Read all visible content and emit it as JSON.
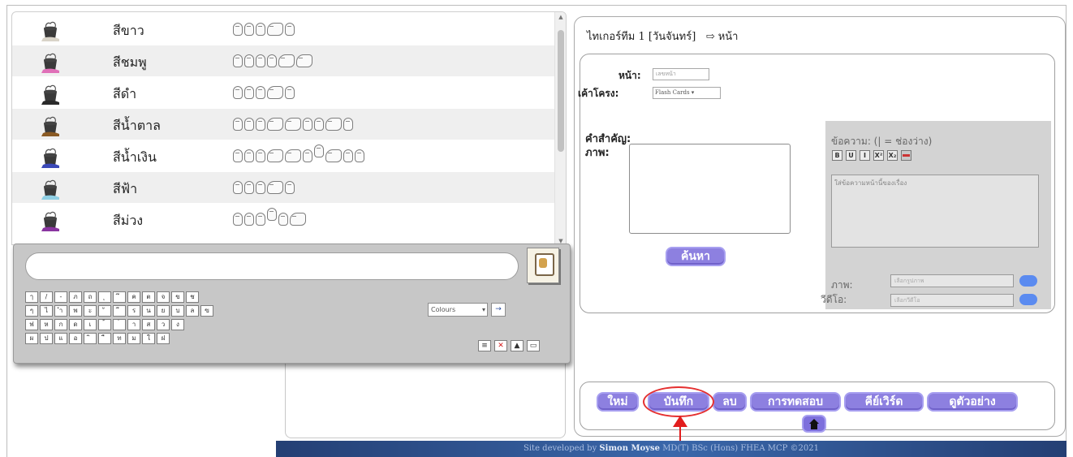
{
  "sign_list": {
    "rows": [
      {
        "word": "สีขาว",
        "paint_color": "#d9d4c8",
        "glyphs": [
          "n",
          "n",
          "n",
          "w",
          "n"
        ]
      },
      {
        "word": "สีชมพู",
        "paint_color": "#e070b8",
        "glyphs": [
          "n",
          "n",
          "n",
          "n",
          "w",
          "w"
        ]
      },
      {
        "word": "สีดำ",
        "paint_color": "#2a2a2a",
        "glyphs": [
          "n",
          "n",
          "n",
          "w",
          "n"
        ]
      },
      {
        "word": "สีน้ำตาล",
        "paint_color": "#8a5a24",
        "glyphs": [
          "n",
          "n",
          "n",
          "w",
          "w",
          "n",
          "n",
          "w",
          "n"
        ]
      },
      {
        "word": "สีน้ำเงิน",
        "paint_color": "#3b49b8",
        "glyphs": [
          "n",
          "n",
          "n",
          "w",
          "w",
          "n",
          "up",
          "w",
          "n",
          "n"
        ]
      },
      {
        "word": "สีฟ้า",
        "paint_color": "#8fcfe4",
        "glyphs": [
          "n",
          "n",
          "n",
          "w",
          "n"
        ]
      },
      {
        "word": "สีม่วง",
        "paint_color": "#8a35a0",
        "glyphs": [
          "n",
          "n",
          "n",
          "up",
          "n",
          "w"
        ]
      }
    ]
  },
  "keyboard": {
    "rows": [
      [
        "ๅ",
        "/",
        "-",
        "ภ",
        "ถ",
        "ุ",
        "ึ",
        "ค",
        "ต",
        "จ",
        "ข",
        "ช"
      ],
      [
        "ๆ",
        "ไ",
        "ำ",
        "พ",
        "ะ",
        "ั",
        "ี",
        "ร",
        "น",
        "ย",
        "บ",
        "ล",
        "ฃ"
      ],
      [
        "ฟ",
        "ห",
        "ก",
        "ด",
        "เ",
        "้",
        "่",
        "า",
        "ส",
        "ว",
        "ง"
      ],
      [
        "ผ",
        "ป",
        "แ",
        "อ",
        "ิ",
        "ื",
        "ท",
        "ม",
        "ใ",
        "ฝ"
      ]
    ],
    "select_label": "Colours",
    "go_label": "→",
    "tools": [
      "≡",
      "✕",
      "▲",
      "▭"
    ]
  },
  "editor": {
    "title": "ไทเกอร์ทีม 1 [วันจันทร์]",
    "page_link": "⇨ หน้า",
    "page_label": "หน้า:",
    "page_placeholder": "เลขหน้า",
    "template_label": "เค้าโครง:",
    "template_value": "Flash Cards",
    "keyword_label": "คำสำคัญ:",
    "image_label": "ภาพ:",
    "search_button": "ค้นหา",
    "text_panel": {
      "title": "ข้อความ: (| = ช่องว่าง)",
      "format_buttons": [
        "B",
        "U",
        "I",
        "X²",
        "X₂",
        ""
      ],
      "textarea_placeholder": "ใส่ข้อความหน้านี้ของเรื่อง",
      "image_label": "ภาพ:",
      "image_field": "เลือกรูปภาพ",
      "video_label": "วีดีโอ:",
      "video_field": "เลือกวีดีโอ"
    },
    "actions": {
      "new": "ใหม่",
      "save": "บันทึก",
      "delete": "ลบ",
      "test": "การทดสอบ",
      "keywords": "คีย์เวิร์ด",
      "preview": "ดูตัวอย่าง"
    }
  },
  "footer": {
    "text": "Site developed by",
    "author": "Simon Moyse",
    "credentials": "MD(T) BSc (Hons) FHEA MCP ©2021"
  },
  "colors": {
    "accent_button": "#8d80e0",
    "annotation": "#e21d1d",
    "footer_bg": "#2f5494"
  }
}
